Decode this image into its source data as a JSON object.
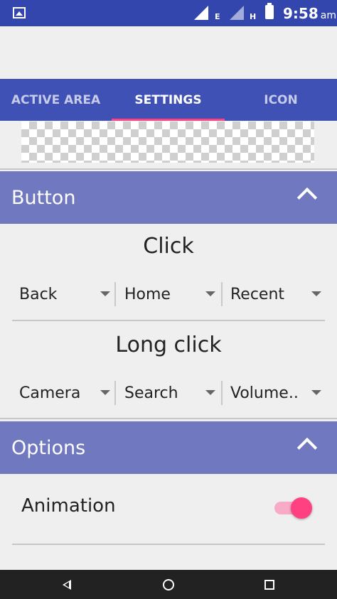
{
  "status_bar": {
    "time": "9:58",
    "ampm": "am",
    "network_labels": [
      "E",
      "H"
    ],
    "icons": [
      "gallery-icon",
      "signal-icon",
      "battery-icon"
    ]
  },
  "tabs": [
    {
      "label": "ACTIVE AREA",
      "active": false
    },
    {
      "label": "SETTINGS",
      "active": true
    },
    {
      "label": "ICON",
      "active": false
    }
  ],
  "button_section": {
    "title": "Button",
    "click_heading": "Click",
    "click_options": [
      "Back",
      "Home",
      "Recent"
    ],
    "long_click_heading": "Long click",
    "long_click_options": [
      "Camera",
      "Search",
      "Volume.."
    ]
  },
  "options_section": {
    "title": "Options",
    "animation_label": "Animation",
    "animation_enabled": true
  },
  "colors": {
    "status_bar": "#3346ad",
    "tab_bar": "#3f51b5",
    "section_header": "#7079c0",
    "accent": "#ff4081"
  }
}
